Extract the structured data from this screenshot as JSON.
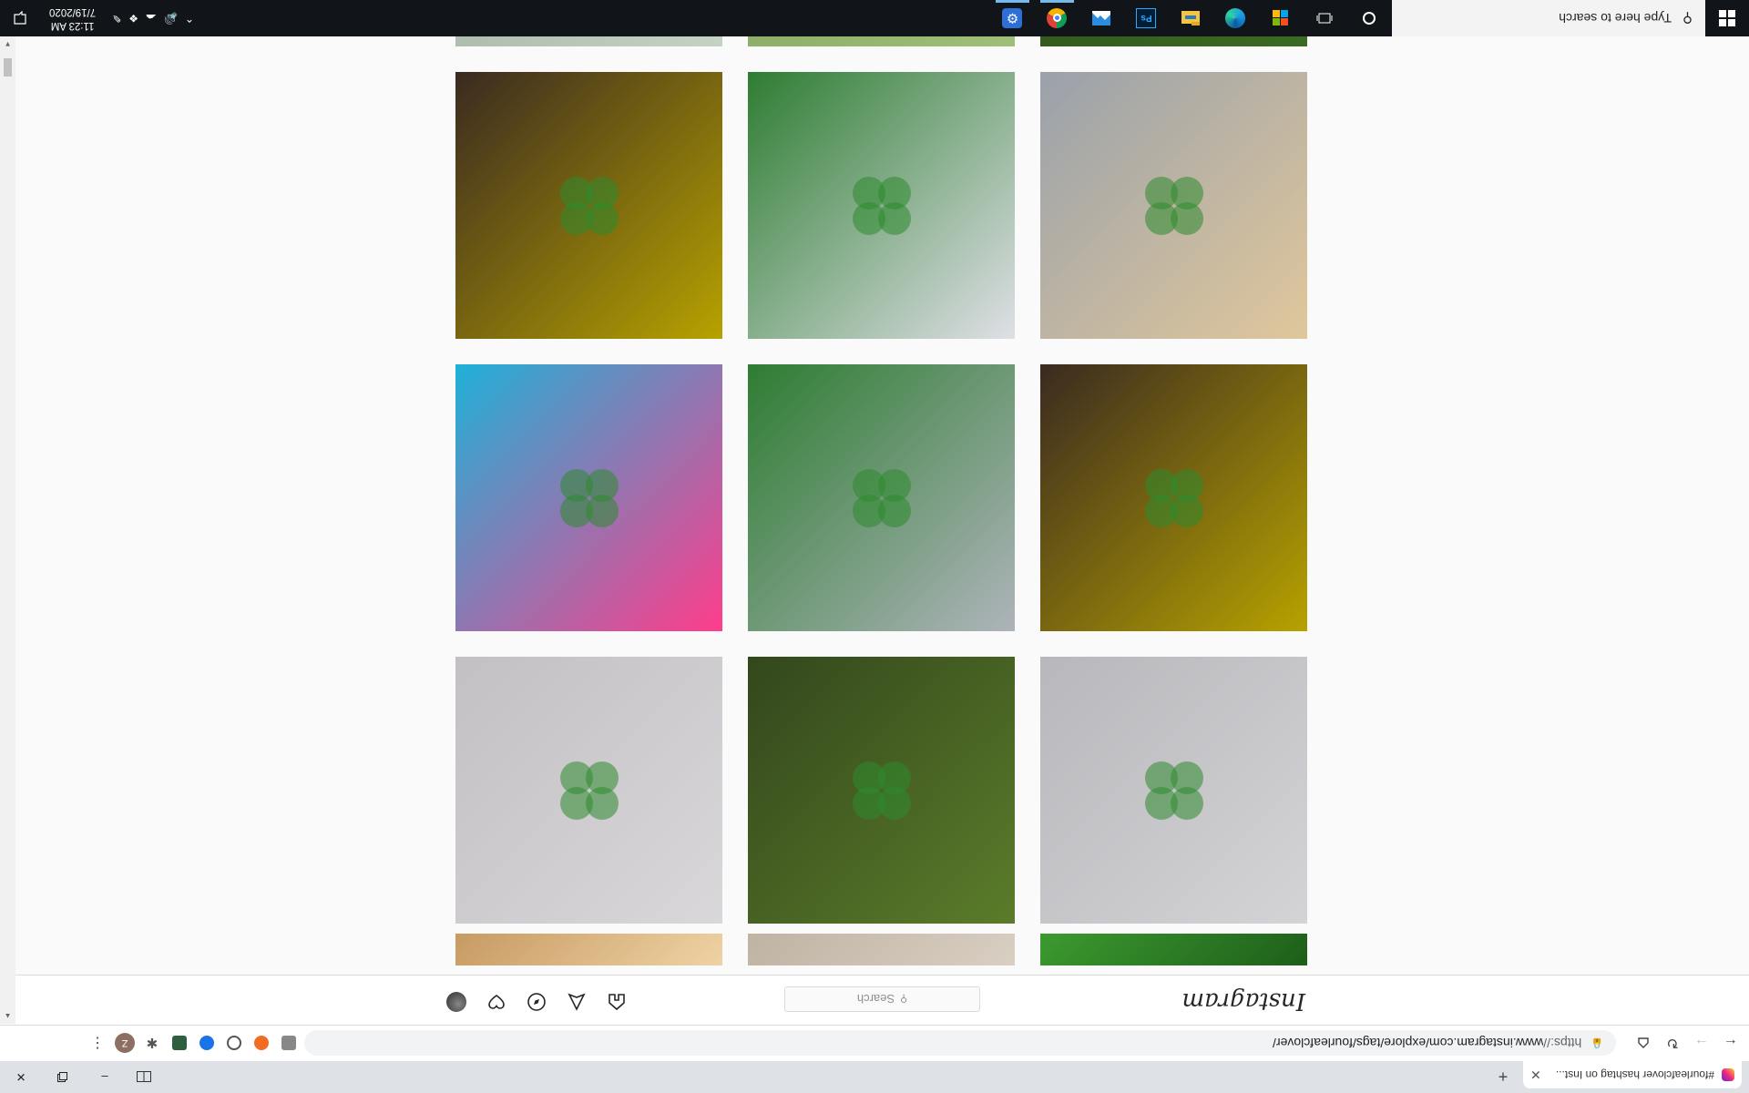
{
  "browser": {
    "tab_title": "#fourleafclover hashtag on Inst...",
    "url_scheme": "https://",
    "url_rest": "www.instagram.com/explore/tags/fourleafclover/",
    "profile_initial": "Z"
  },
  "instagram": {
    "logo": "Instagram",
    "search_placeholder": "Search"
  },
  "taskbar": {
    "search_placeholder": "Type here to search",
    "time": "11:23 AM",
    "date": "7/19/2020"
  },
  "grid": {
    "rows": [
      {
        "tiles": [
          {
            "name": "tile-grass-blades",
            "colors": [
              "#1d5e1a",
              "#3c9a2f"
            ]
          },
          {
            "name": "tile-beige",
            "colors": [
              "#d9cfc2",
              "#bfb3a3"
            ]
          },
          {
            "name": "tile-hand-cookie",
            "colors": [
              "#efd3a4",
              "#c79a63"
            ]
          }
        ]
      },
      {
        "tiles": [
          {
            "name": "tile-hand-clover-gray",
            "colors": [
              "#d4d3d6",
              "#b8b7bb"
            ]
          },
          {
            "name": "tile-dog-grass",
            "colors": [
              "#5b7c2a",
              "#33471c"
            ]
          },
          {
            "name": "tile-hand-clover-painted-nails",
            "colors": [
              "#d9d7da",
              "#c3c0c4"
            ]
          }
        ]
      },
      {
        "tiles": [
          {
            "name": "tile-leaf-mustard",
            "colors": [
              "#b7a200",
              "#3a2a20"
            ]
          },
          {
            "name": "tile-clover-vase",
            "colors": [
              "#aeb4ba",
              "#2e7d32"
            ]
          },
          {
            "name": "tile-rainbow-leather",
            "colors": [
              "#ff3d8b",
              "#1fb1d8"
            ]
          }
        ]
      },
      {
        "tiles": [
          {
            "name": "tile-grapefruit-clover",
            "colors": [
              "#e0c79b",
              "#9aa1ab"
            ]
          },
          {
            "name": "tile-clover-wood",
            "colors": [
              "#dfe0e6",
              "#2e7d32"
            ]
          },
          {
            "name": "tile-leaf-mustard-2",
            "colors": [
              "#b7a200",
              "#3a2a20"
            ]
          }
        ]
      },
      {
        "tiles": [
          {
            "name": "tile-green-top",
            "colors": [
              "#3b6b22",
              "#2d4b18"
            ]
          },
          {
            "name": "tile-green-light",
            "colors": [
              "#9fbf7a",
              "#7ba05a"
            ]
          },
          {
            "name": "tile-green-flower",
            "colors": [
              "#c5d3c4",
              "#9aa89a"
            ]
          }
        ]
      }
    ]
  }
}
